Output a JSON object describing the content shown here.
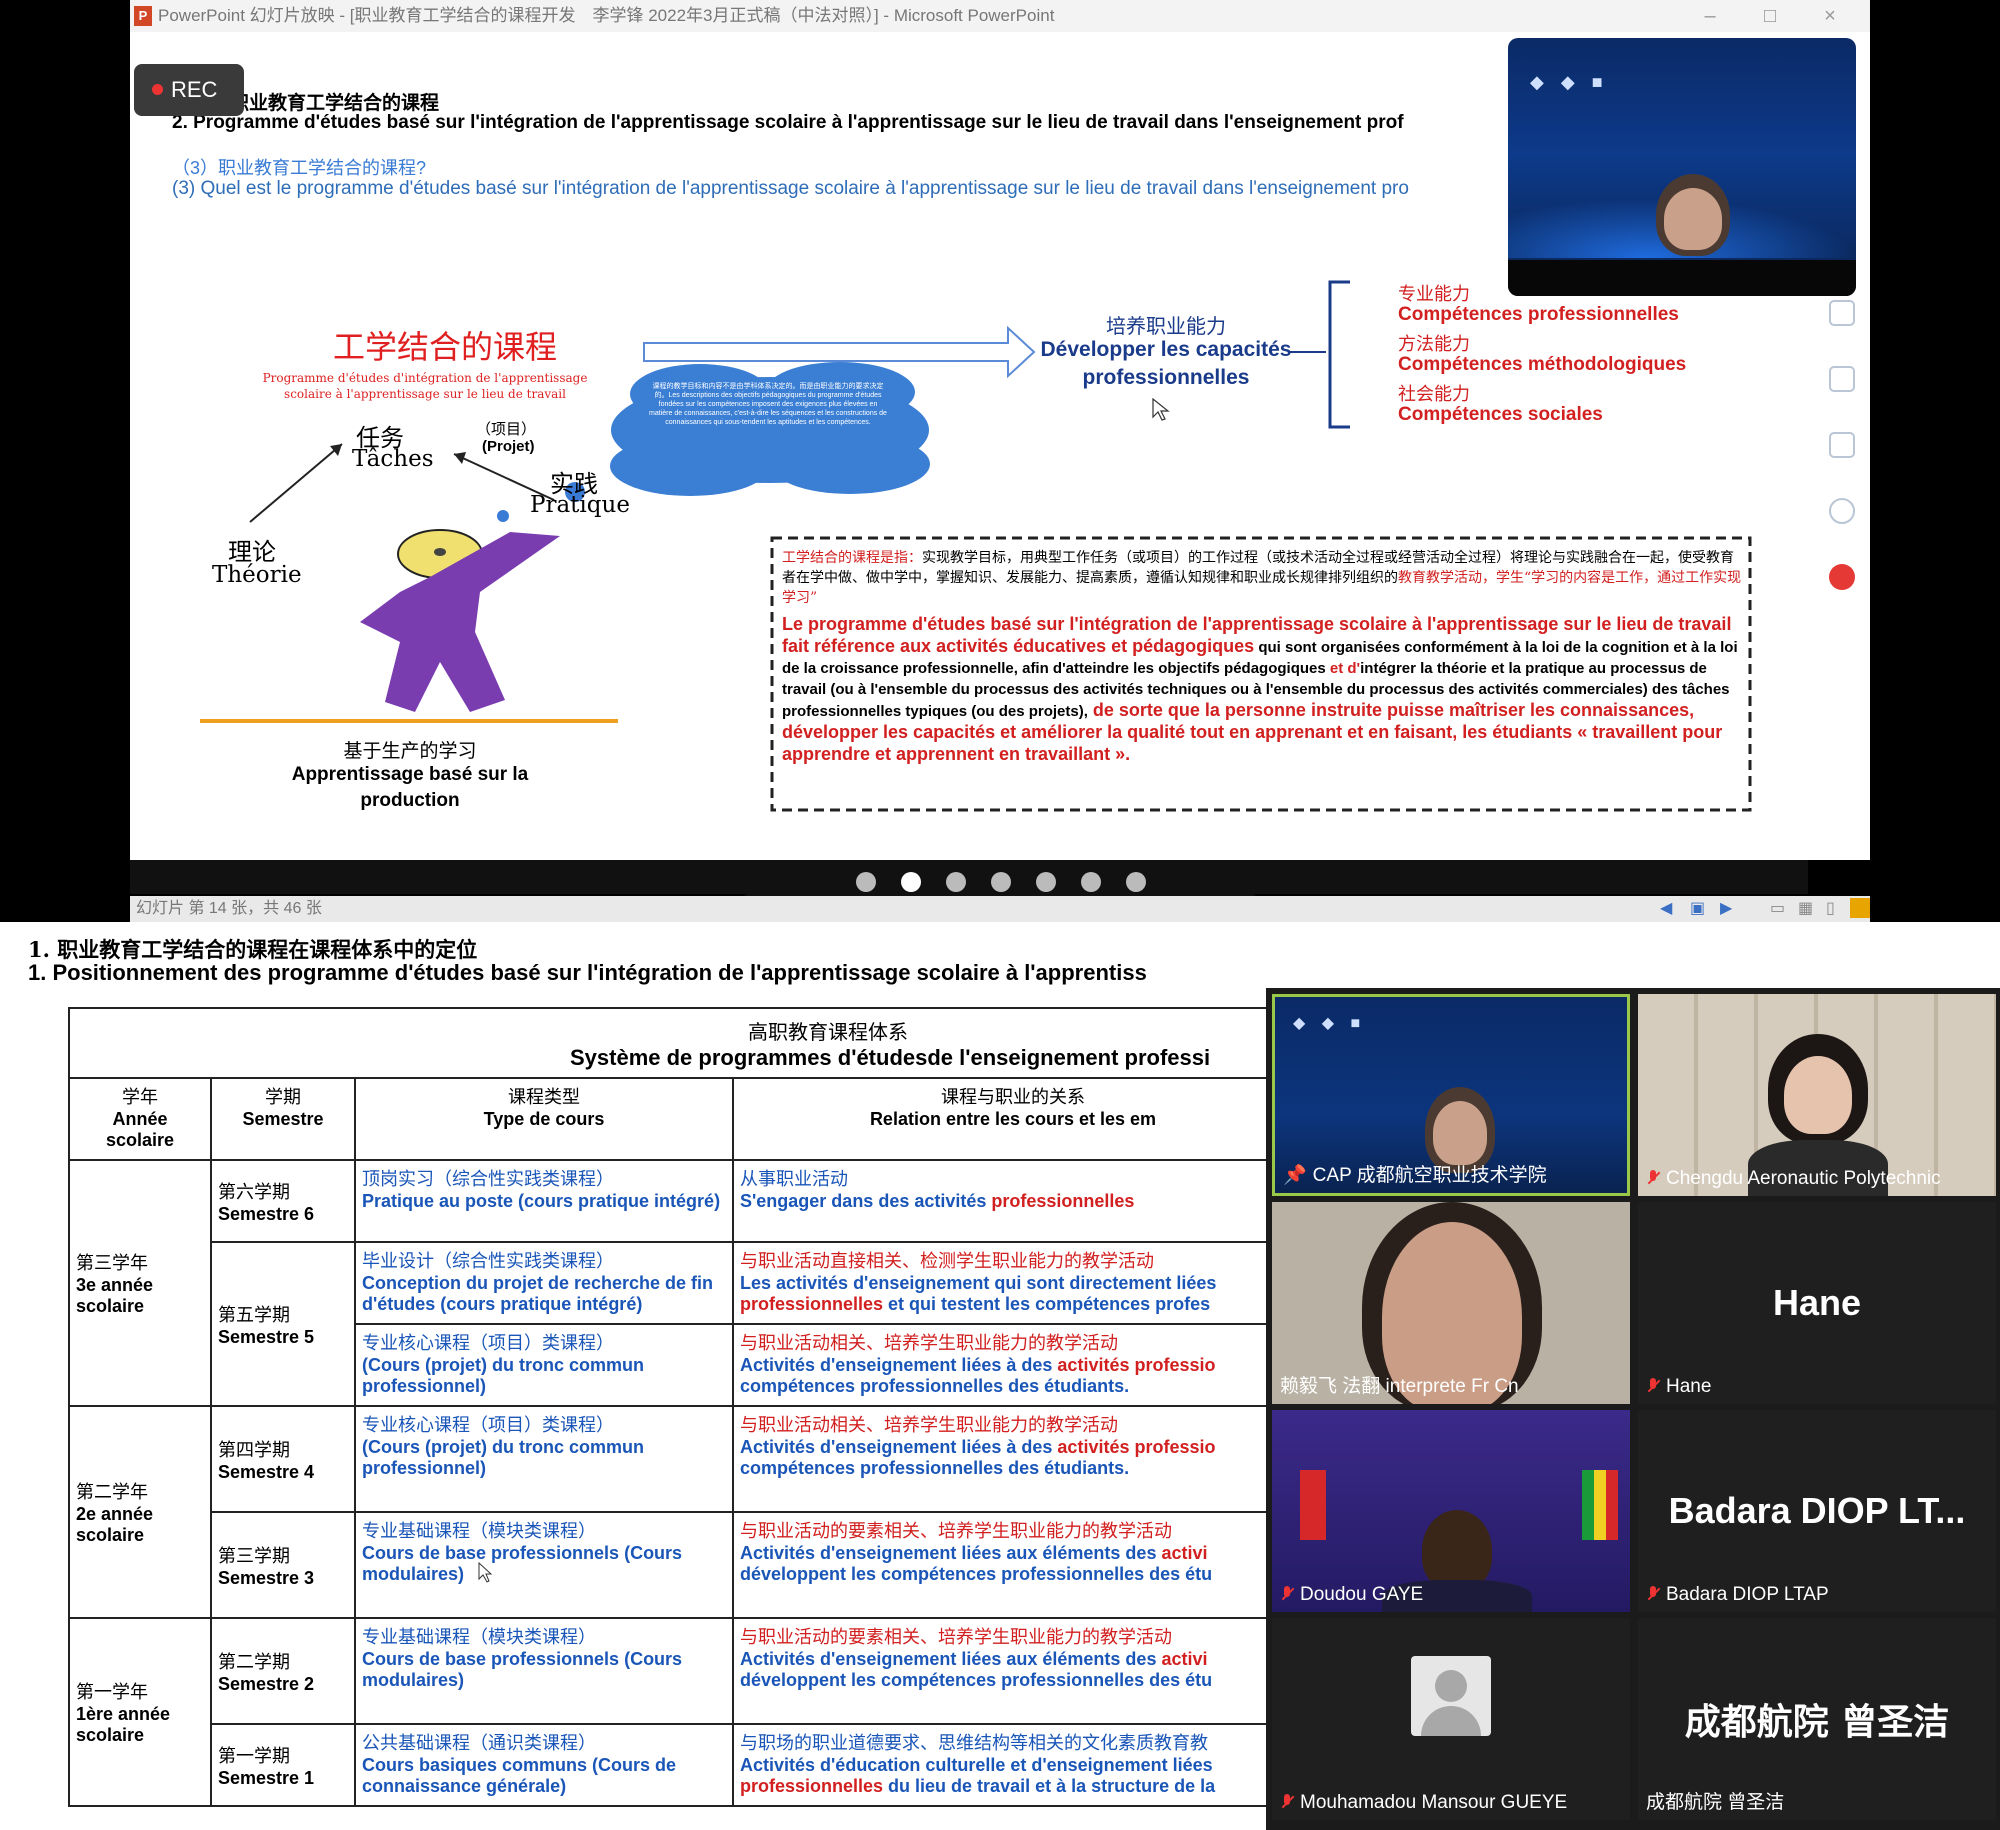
{
  "top": {
    "ppt_window_title": "PowerPoint 幻灯片放映 - [职业教育工学结合的课程开发　李学锋 2022年3月正式稿（中法对照）] - Microsoft PowerPoint",
    "rec_label": "REC",
    "slide": {
      "title_cn": "职业教育工学结合的课程",
      "title_fr": "2. Programme d'études basé sur l'intégration de l'apprentissage scolaire à l'apprentissage sur le lieu de travail dans l'enseignement prof",
      "subtitle_cn": "（3）职业教育工学结合的课程?",
      "subtitle_fr": "(3) Quel est le programme d'études basé sur l'intégration de l'apprentissage scolaire à l'apprentissage sur le lieu de travail dans l'enseignement pro",
      "diagram_title_cn": "工学结合的课程",
      "diagram_title_fr": "Programme d'études d'intégration de l'apprentissage scolaire à l'apprentissage sur le lieu de travail",
      "task_cn": "任务",
      "task_fr": "Tâches",
      "project_cn": "（项目）",
      "project_fr": "(Projet)",
      "practice_cn": "实践",
      "practice_fr": "Pratique",
      "theory_cn": "理论",
      "theory_fr": "Théorie",
      "production_cn": "基于生产的学习",
      "production_fr": "Apprentissage basé sur la production",
      "cloud_text": "课程的教学目标和内容不是由学科体系决定的。而是由职业能力的要求决定的。Les descriptions des objectifs pédagogiques du programme d'études fondées sur les compétences imposent des exigences plus élevées en matière de connaissances, c'est-à-dire les séquences et les constructions de connaissances qui sous-tendent les aptitudes et les compétences.",
      "develop_cn": "培养职业能力",
      "develop_fr": "Développer les capacités professionnelles",
      "comp1_cn": "专业能力",
      "comp1_fr": "Compétences professionnelles",
      "comp2_cn": "方法能力",
      "comp2_fr": "Compétences méthodologiques",
      "comp3_cn": "社会能力",
      "comp3_fr": "Compétences sociales",
      "def_cn_red": "工学结合的课程是指：",
      "def_cn_body": "实现教学目标，用典型工作任务（或项目）的工作过程（或技术活动全过程或经营活动全过程）将理论与实践融合在一起，使受教育者在学中做、做中学中，掌握知识、发展能力、提高素质，遵循认知规律和职业成长规律排列组织的",
      "def_cn_red2": "教育教学活动，学生“学习的内容是工作，通过工作实现学习”",
      "def_fr_red1": "Le programme d'études basé sur l'intégration de l'apprentissage scolaire à l'apprentissage sur le lieu de travail fait référence aux activités éducatives et pédagogiques",
      "def_fr_body1": " qui sont organisées conformément à la loi de la cognition et à la loi de la croissance professionnelle, afin d'atteindre les objectifs pédagogiques ",
      "def_fr_red2": "et d'",
      "def_fr_body2": "intégrer la théorie et la pratique au processus de travail (ou à l'ensemble du processus des activités techniques ou à l'ensemble du processus des activités commerciales) des tâches professionnelles typiques (ou des projets),",
      "def_fr_red3": " de sorte que la personne instruite puisse maîtriser les connaissances, développer les capacités et améliorer la qualité tout en apprenant et en faisant, les étudiants « travaillent pour apprendre et apprennent en travaillant »."
    },
    "status_text": "幻灯片 第 14 张，共 46 张",
    "presenter_name": ""
  },
  "bottom": {
    "heading_cn": "1. 职业教育工学结合的课程在课程体系中的定位",
    "heading_fr": "1. Positionnement des programme d'études basé sur l'intégration de l'apprentissage scolaire à l'apprentiss",
    "table": {
      "caption_cn": "高职教育课程体系",
      "caption_fr": "Système de programmes d'étudesde l'enseignement professi",
      "h_year_cn": "学年",
      "h_year_fr": "Année scolaire",
      "h_sem_cn": "学期",
      "h_sem_fr": "Semestre",
      "h_type_cn": "课程类型",
      "h_type_fr": "Type de cours",
      "h_rel_cn": "课程与职业的关系",
      "h_rel_fr": "Relation entre les cours et les em",
      "year3_cn": "第三学年",
      "year3_fr": "3e année scolaire",
      "year2_cn": "第二学年",
      "year2_fr": "2e année scolaire",
      "year1_cn": "第一学年",
      "year1_fr": "1ère année scolaire",
      "rows": [
        {
          "sem_cn": "第六学期",
          "sem_fr": "Semestre 6",
          "type_cn": "顶岗实习（综合性实践类课程）",
          "type_fr": "Pratique au poste (cours pratique intégré)",
          "rel_cn": "从事职业活动",
          "rel_fr": "S'engager dans des activités ",
          "rel_fr_red": "professionnelles",
          "rel_fr2": ""
        },
        {
          "sem_cn": "第五学期",
          "sem_fr": "Semestre 5",
          "type_cn": "毕业设计（综合性实践类课程）",
          "type_fr": "Conception du projet de recherche de fin d'études (cours pratique intégré)",
          "rel_cn": "与职业活动直接相关、检测学生职业能力的教学活动",
          "rel_fr": "Les activités d'enseignement qui sont directement liées",
          "rel_fr_red": "professionnelles",
          "rel_fr2": " et qui testent les compétences profes"
        },
        {
          "sem_cn": "",
          "sem_fr": "",
          "type_cn": "专业核心课程（项目）类课程）",
          "type_fr": "(Cours (projet) du tronc commun professionnel)",
          "rel_cn": "与职业活动相关、培养学生职业能力的教学活动",
          "rel_fr": "Activités d'enseignement liées à des ",
          "rel_fr_red": "activités professio",
          "rel_fr2": "compétences professionnelles des étudiants."
        },
        {
          "sem_cn": "第四学期",
          "sem_fr": "Semestre 4",
          "type_cn": "专业核心课程（项目）类课程）",
          "type_fr": "(Cours (projet) du tronc commun professionnel)",
          "rel_cn": "与职业活动相关、培养学生职业能力的教学活动",
          "rel_fr": "Activités d'enseignement liées à des ",
          "rel_fr_red": "activités professio",
          "rel_fr2": "compétences professionnelles des étudiants."
        },
        {
          "sem_cn": "第三学期",
          "sem_fr": "Semestre 3",
          "type_cn": "专业基础课程（模块类课程）",
          "type_fr": "Cours de base professionnels (Cours modulaires)",
          "rel_cn": "与职业活动的要素相关、培养学生职业能力的教学活动",
          "rel_fr": "Activités d'enseignement liées aux éléments des ",
          "rel_fr_red": "activi",
          "rel_fr2": "développent les compétences professionnelles des étu"
        },
        {
          "sem_cn": "第二学期",
          "sem_fr": "Semestre 2",
          "type_cn": "专业基础课程（模块类课程）",
          "type_fr": "Cours de base professionnels (Cours modulaires)",
          "rel_cn": "与职业活动的要素相关、培养学生职业能力的教学活动",
          "rel_fr": "Activités d'enseignement liées aux éléments des ",
          "rel_fr_red": "activi",
          "rel_fr2": "développent les compétences professionnelles des étu"
        },
        {
          "sem_cn": "第一学期",
          "sem_fr": "Semestre 1",
          "type_cn": "公共基础课程（通识类课程）",
          "type_fr": "Cours basiques communs (Cours de connaissance générale)",
          "rel_cn": "与职场的职业道德要求、思维结构等相关的文化素质教育教",
          "rel_fr": "Activités d'éducation culturelle et d'enseignement liées",
          "rel_fr_red": "professionnelles",
          "rel_fr2": " du lieu de travail et à la structure de la"
        }
      ]
    },
    "gallery": [
      {
        "name": "CAP 成都航空职业技术学院",
        "big": ""
      },
      {
        "name": "Chengdu Aeronautic Polytechnic",
        "big": ""
      },
      {
        "name": "赖毅飞 法翻 interprete Fr Cn",
        "big": ""
      },
      {
        "name": "Hane",
        "big": "Hane"
      },
      {
        "name": "Doudou GAYE",
        "big": ""
      },
      {
        "name": "Badara DIOP LTAP",
        "big": "Badara DIOP LT..."
      },
      {
        "name": "Mouhamadou Mansour GUEYE",
        "big": ""
      },
      {
        "name": "成都航院 曾圣洁",
        "big": "成都航院 曾圣洁"
      }
    ]
  }
}
